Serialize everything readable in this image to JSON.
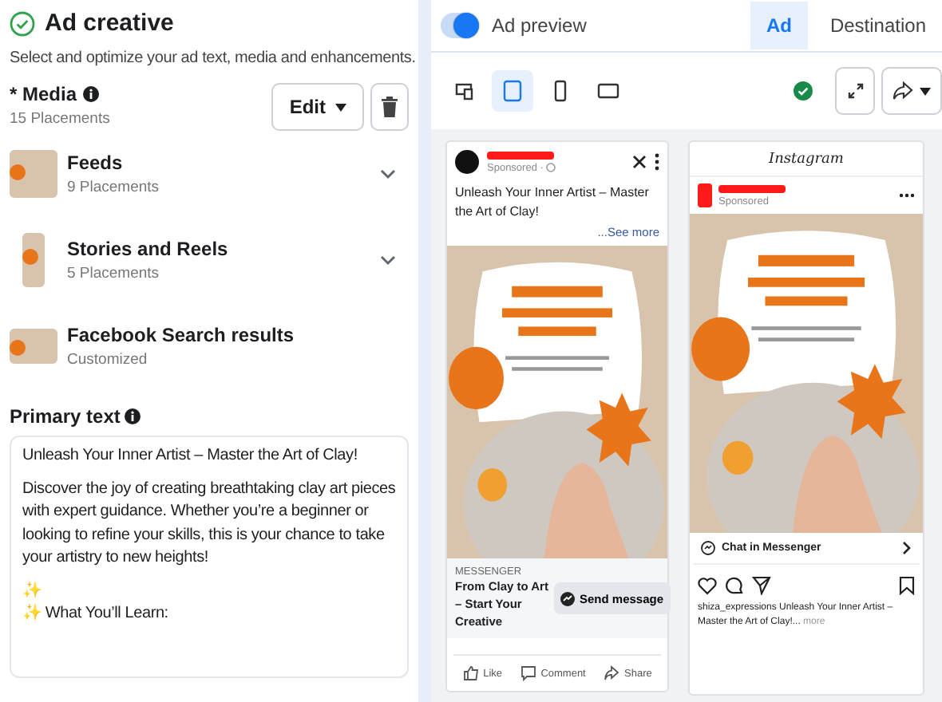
{
  "ad_creative": {
    "complete": true,
    "title": "Ad creative",
    "description": "Select and optimize your ad text, media and enhancements."
  },
  "media": {
    "required_mark": "*",
    "label": "Media",
    "count": "15 Placements",
    "edit_button": "Edit",
    "placements": [
      {
        "kind": "square",
        "name": "Feeds",
        "detail": "9 Placements",
        "expandable": true
      },
      {
        "kind": "tall",
        "name": "Stories and Reels",
        "detail": "5 Placements",
        "expandable": true
      },
      {
        "kind": "wide",
        "name": "Facebook Search results",
        "detail": "Customized",
        "expandable": false
      }
    ]
  },
  "primary_text": {
    "label": "Primary text",
    "lines": [
      "Unleash Your Inner Artist – Master the Art of Clay!",
      "Discover the joy of creating breathtaking clay art pieces with expert guidance. Whether you’re a beginner or looking to refine your skills, this is your chance to take your artistry to new heights!",
      "✨",
      "✨ What You’ll Learn:"
    ]
  },
  "preview": {
    "toggle_on": true,
    "label": "Ad preview",
    "tabs": [
      {
        "label": "Ad",
        "selected": true
      },
      {
        "label": "Destination",
        "selected": false
      }
    ],
    "devices": [
      {
        "kind": "multi",
        "selected": false
      },
      {
        "kind": "tablet",
        "selected": true
      },
      {
        "kind": "phone",
        "selected": false
      },
      {
        "kind": "desktop",
        "selected": false
      }
    ],
    "approved": true
  },
  "facebook_card": {
    "sponsored": "Sponsored · ",
    "text": "Unleash Your Inner Artist – Master the Art of Clay!",
    "see_more": "...See more",
    "cta_label": "MESSENGER",
    "headline": "From Clay to Art – Start Your Creative",
    "button": "Send message",
    "actions": [
      {
        "kind": "like",
        "label": "Like"
      },
      {
        "kind": "comment",
        "label": "Comment"
      },
      {
        "kind": "share",
        "label": "Share"
      }
    ]
  },
  "instagram_card": {
    "app": "Instagram",
    "sponsored": "Sponsored",
    "chat": "Chat in Messenger",
    "caption_user": "shiza_expressions",
    "caption": "Unleash Your Inner Artist – Master the Art of Clay!...",
    "more": "more"
  }
}
